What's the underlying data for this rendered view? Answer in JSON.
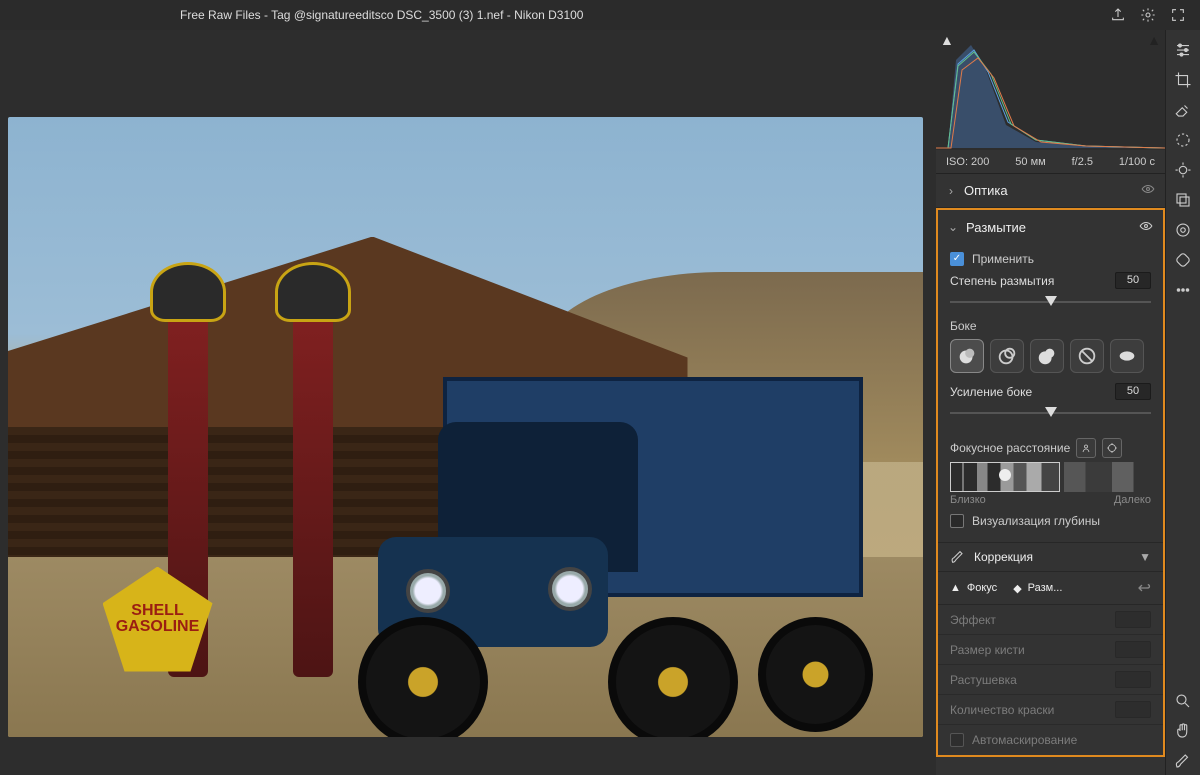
{
  "title": "Free Raw Files - Tag @signatureeditsco DSC_3500 (3) 1.nef  -  Nikon D3100",
  "exif": {
    "iso": "ISO: 200",
    "focal": "50 мм",
    "aperture": "f/2.5",
    "shutter": "1/100 с"
  },
  "optics": {
    "title": "Оптика"
  },
  "blur": {
    "title": "Размытие",
    "apply_label": "Применить",
    "amount_label": "Степень размытия",
    "amount_value": "50",
    "bokeh_label": "Боке",
    "bokeh_gain_label": "Усиление боке",
    "bokeh_gain_value": "50",
    "focal_label": "Фокусное расстояние",
    "near_label": "Близко",
    "far_label": "Далеко",
    "depth_vis_label": "Визуализация глубины"
  },
  "correction": {
    "title": "Коррекция",
    "focus_tab": "Фокус",
    "blur_tab": "Разм...",
    "effect": "Эффект",
    "brush_size": "Размер кисти",
    "feather": "Растушевка",
    "paint_amount": "Количество краски",
    "automask": "Автомаскирование"
  },
  "canvas": {
    "sign_text": "SHELL GASOLINE"
  },
  "rail_tools": [
    "sliders",
    "crop",
    "eraser",
    "circle-select",
    "eye-target",
    "layers",
    "radial",
    "patch",
    "more"
  ],
  "rail_bottom": [
    "zoom",
    "hand",
    "brush"
  ]
}
